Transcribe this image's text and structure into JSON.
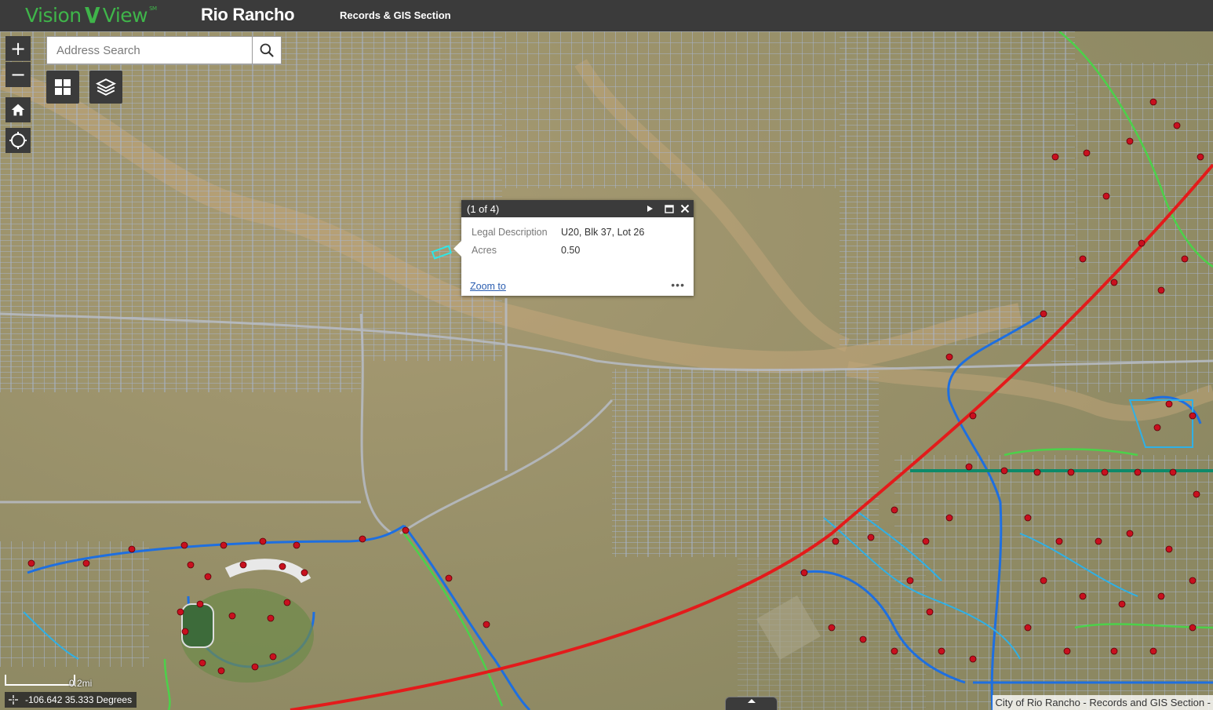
{
  "header": {
    "logo_left": "Vision",
    "logo_right": "View",
    "logo_mark": "SM",
    "app_title": "Rio Rancho",
    "section_title": "Records & GIS Section"
  },
  "map_controls": {
    "zoom_in": "+",
    "zoom_out": "−",
    "home_icon": "home-icon",
    "locate_icon": "locate-icon",
    "widgets_icon": "grid-icon",
    "layers_icon": "layers-icon"
  },
  "search": {
    "placeholder": "Address Search",
    "value": "",
    "button_icon": "search-icon"
  },
  "popup": {
    "counter": "(1 of 4)",
    "attributes": [
      {
        "label": "Legal Description",
        "value": "U20, Blk 37, Lot 26"
      },
      {
        "label": "Acres",
        "value": "0.50"
      }
    ],
    "zoom_to": "Zoom to",
    "more": "•••"
  },
  "scale": {
    "label": "0.2mi"
  },
  "coordinates": {
    "text": "-106.642 35.333 Degrees"
  },
  "attribution": "City of Rio Rancho - Records and GIS Section -",
  "colors": {
    "header_bg": "#3b3b3b",
    "logo_green": "#3fb54a",
    "parcel_line": "#a9b8d6",
    "water_line": "#1e6fe0",
    "highway": "#e31b1b",
    "hydrant": "#c8101e"
  }
}
